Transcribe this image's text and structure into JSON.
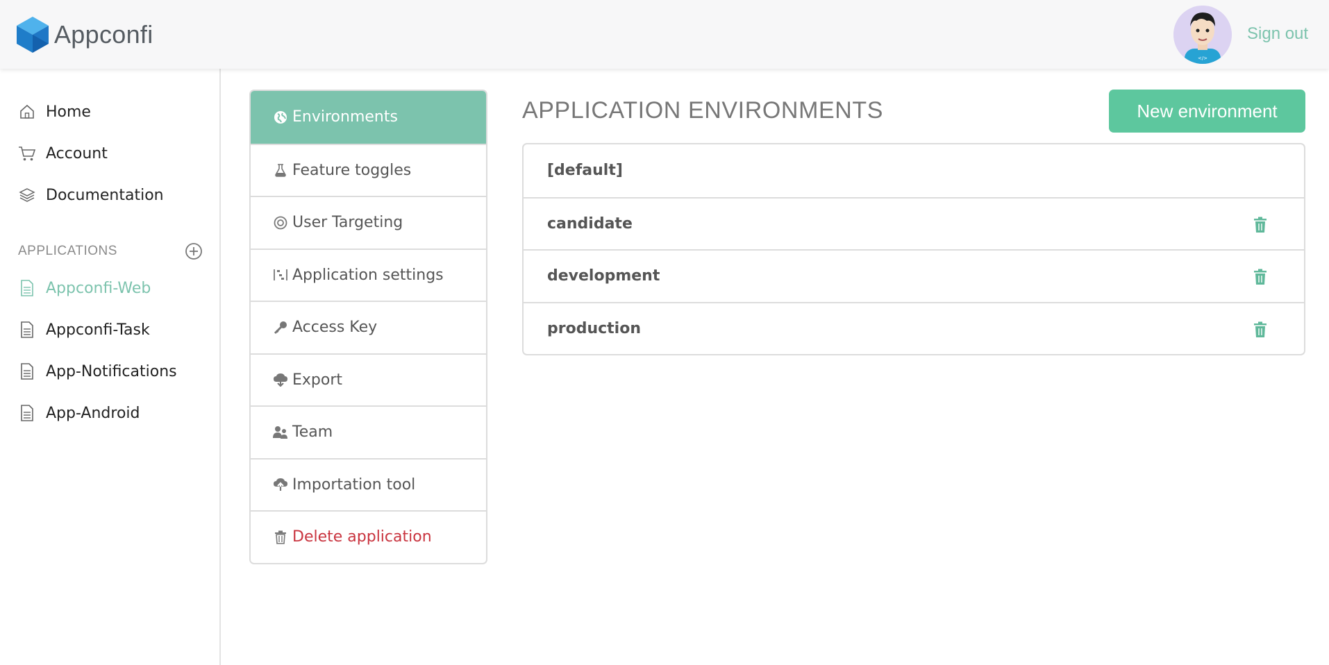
{
  "header": {
    "app_name": "Appconfi",
    "sign_out": "Sign out"
  },
  "sidebar": {
    "nav": [
      {
        "label": "Home",
        "icon": "home-icon"
      },
      {
        "label": "Account",
        "icon": "cart-icon"
      },
      {
        "label": "Documentation",
        "icon": "layers-icon"
      }
    ],
    "applications_title": "APPLICATIONS",
    "applications": [
      {
        "label": "Appconfi-Web",
        "icon": "document-icon",
        "active": true
      },
      {
        "label": "Appconfi-Task",
        "icon": "document-icon",
        "active": false
      },
      {
        "label": "App-Notifications",
        "icon": "document-icon",
        "active": false
      },
      {
        "label": "App-Android",
        "icon": "document-icon",
        "active": false
      }
    ]
  },
  "settings_menu": {
    "items": [
      {
        "label": "Environments",
        "icon": "globe-icon",
        "active": true
      },
      {
        "label": "Feature toggles",
        "icon": "flask-icon"
      },
      {
        "label": "User Targeting",
        "icon": "target-icon"
      },
      {
        "label": "Application settings",
        "icon": "sliders-icon"
      },
      {
        "label": "Access Key",
        "icon": "key-icon"
      },
      {
        "label": "Export",
        "icon": "cloud-download-icon"
      },
      {
        "label": "Team",
        "icon": "team-icon"
      },
      {
        "label": "Importation tool",
        "icon": "cloud-upload-icon"
      },
      {
        "label": "Delete application",
        "icon": "trash-icon",
        "danger": true
      }
    ]
  },
  "main": {
    "title": "APPLICATION ENVIRONMENTS",
    "new_button": "New environment",
    "environments": [
      {
        "name": "[default]",
        "deletable": false
      },
      {
        "name": "candidate",
        "deletable": true
      },
      {
        "name": "development",
        "deletable": true
      },
      {
        "name": "production",
        "deletable": true
      }
    ]
  },
  "colors": {
    "accent": "#7cc3ad",
    "button": "#5dc79e",
    "danger": "#c9343f"
  }
}
